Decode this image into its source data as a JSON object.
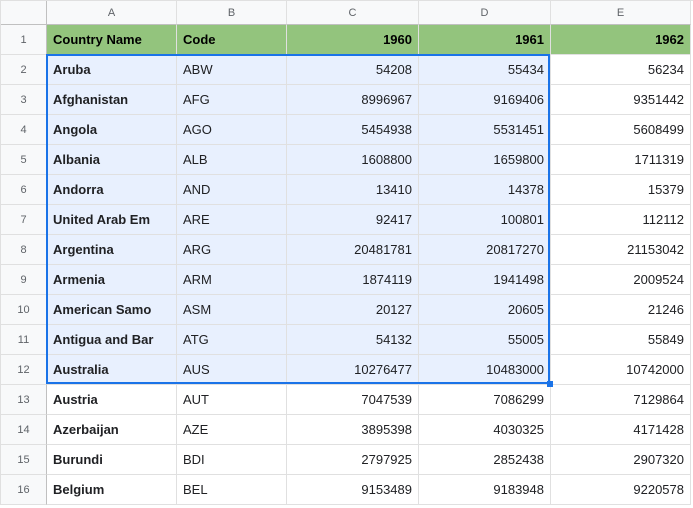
{
  "columns": [
    "A",
    "B",
    "C",
    "D",
    "E"
  ],
  "row_numbers": [
    1,
    2,
    3,
    4,
    5,
    6,
    7,
    8,
    9,
    10,
    11,
    12,
    13,
    14,
    15,
    16
  ],
  "header_row": {
    "country_name": "Country Name",
    "code": "Code",
    "y1960": "1960",
    "y1961": "1961",
    "y1962": "1962"
  },
  "rows": [
    {
      "name": "Aruba",
      "code": "ABW",
      "y1960": "54208",
      "y1961": "55434",
      "y1962": "56234"
    },
    {
      "name": "Afghanistan",
      "code": "AFG",
      "y1960": "8996967",
      "y1961": "9169406",
      "y1962": "9351442"
    },
    {
      "name": "Angola",
      "code": "AGO",
      "y1960": "5454938",
      "y1961": "5531451",
      "y1962": "5608499"
    },
    {
      "name": "Albania",
      "code": "ALB",
      "y1960": "1608800",
      "y1961": "1659800",
      "y1962": "1711319"
    },
    {
      "name": "Andorra",
      "code": "AND",
      "y1960": "13410",
      "y1961": "14378",
      "y1962": "15379"
    },
    {
      "name": "United Arab Em",
      "code": "ARE",
      "y1960": "92417",
      "y1961": "100801",
      "y1962": "112112"
    },
    {
      "name": "Argentina",
      "code": "ARG",
      "y1960": "20481781",
      "y1961": "20817270",
      "y1962": "21153042"
    },
    {
      "name": "Armenia",
      "code": "ARM",
      "y1960": "1874119",
      "y1961": "1941498",
      "y1962": "2009524"
    },
    {
      "name": "American Samo",
      "code": "ASM",
      "y1960": "20127",
      "y1961": "20605",
      "y1962": "21246"
    },
    {
      "name": "Antigua and Bar",
      "code": "ATG",
      "y1960": "54132",
      "y1961": "55005",
      "y1962": "55849"
    },
    {
      "name": "Australia",
      "code": "AUS",
      "y1960": "10276477",
      "y1961": "10483000",
      "y1962": "10742000"
    },
    {
      "name": "Austria",
      "code": "AUT",
      "y1960": "7047539",
      "y1961": "7086299",
      "y1962": "7129864"
    },
    {
      "name": "Azerbaijan",
      "code": "AZE",
      "y1960": "3895398",
      "y1961": "4030325",
      "y1962": "4171428"
    },
    {
      "name": "Burundi",
      "code": "BDI",
      "y1960": "2797925",
      "y1961": "2852438",
      "y1962": "2907320"
    },
    {
      "name": "Belgium",
      "code": "BEL",
      "y1960": "9153489",
      "y1961": "9183948",
      "y1962": "9220578"
    }
  ],
  "selection": {
    "top_row": 2,
    "bottom_row": 12,
    "left_col": "A",
    "right_col": "D"
  }
}
